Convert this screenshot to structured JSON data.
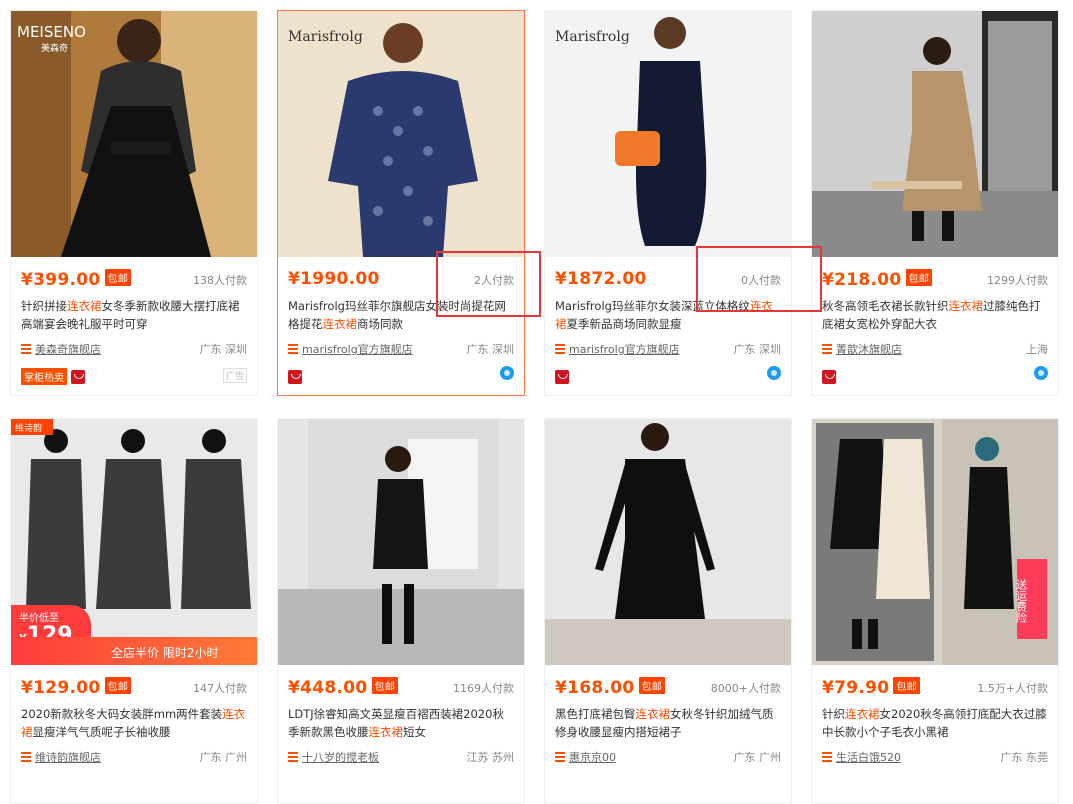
{
  "products": [
    {
      "price": "¥399.00",
      "tag": "包邮",
      "sales": "138人付款",
      "title_a": "针织拼接",
      "title_hl": "连衣裙",
      "title_b": "女冬季新款收腰大摆打底裙高端宴会晚礼服平时可穿",
      "shop": "美森奇旗舰店",
      "location": "广东 深圳",
      "hot": "掌柜热卖",
      "ad": "广告",
      "brand_text": "MEISENO",
      "brand_sub": "美森奇"
    },
    {
      "price": "¥1990.00",
      "tag": "",
      "sales": "2人付款",
      "title_a": "Marisfrolg玛丝菲尔旗舰店女装时尚提花网格提花",
      "title_hl": "连衣裙",
      "title_b": "商场同款",
      "shop": "marisfrolg官方旗舰店",
      "location": "广东 深圳",
      "hot": "",
      "ad": "",
      "brand_text": "Marisfrolg",
      "brand_sub": ""
    },
    {
      "price": "¥1872.00",
      "tag": "",
      "sales": "0人付款",
      "title_a": "Marisfrolg玛丝菲尔女装深蓝立体格纹",
      "title_hl": "连衣裙",
      "title_b": "夏季新品商场同款显瘦",
      "shop": "marisfrolg官方旗舰店",
      "location": "广东 深圳",
      "hot": "",
      "ad": "",
      "brand_text": "Marisfrolg",
      "brand_sub": ""
    },
    {
      "price": "¥218.00",
      "tag": "包邮",
      "sales": "1299人付款",
      "title_a": "秋冬高领毛衣裙长款针织",
      "title_hl": "连衣裙",
      "title_b": "过膝纯色打底裙女宽松外穿配大衣",
      "shop": "菁歆沐旗舰店",
      "location": "上海",
      "hot": "",
      "ad": "",
      "brand_text": "",
      "brand_sub": ""
    },
    {
      "price": "¥129.00",
      "tag": "包邮",
      "sales": "147人付款",
      "title_a": "2020新款秋冬大码女装胖mm两件套装",
      "title_hl": "连衣裙",
      "title_b": "显瘦洋气气质呢子长袖收腰",
      "shop": "维诗韵旗舰店",
      "location": "广东 广州",
      "hot": "",
      "ad": "",
      "brand_text": "维诗韵",
      "brand_sub": "",
      "promo_label": "半价低至",
      "promo_price": "129",
      "promo_text": "全店半价 限时2小时"
    },
    {
      "price": "¥448.00",
      "tag": "包邮",
      "sales": "1169人付款",
      "title_a": "LDTJ徐睿知高文英显瘦百褶西装裙2020秋季新款黑色收腰",
      "title_hl": "连衣裙",
      "title_b": "短女",
      "shop": "十八岁的搅老板",
      "location": "江苏 苏州",
      "hot": "",
      "ad": "",
      "brand_text": "",
      "brand_sub": ""
    },
    {
      "price": "¥168.00",
      "tag": "包邮",
      "sales": "8000+人付款",
      "title_a": "黑色打底裙包臀",
      "title_hl": "连衣裙",
      "title_b": "女秋冬针织加绒气质修身收腰显瘦内搭短裙子",
      "shop": "惠京京00",
      "location": "广东 广州",
      "hot": "",
      "ad": "",
      "brand_text": "",
      "brand_sub": ""
    },
    {
      "price": "¥79.90",
      "tag": "包邮",
      "sales": "1.5万+人付款",
      "title_a": "针织",
      "title_hl": "连衣裙",
      "title_b": "女2020秋冬高领打底配大衣过膝中长款小个子毛衣小黑裙",
      "shop": "生活白饿520",
      "location": "广东 东莞",
      "hot": "",
      "ad": "",
      "brand_text": "",
      "brand_sub": "",
      "promo_side": "送运费险"
    }
  ]
}
